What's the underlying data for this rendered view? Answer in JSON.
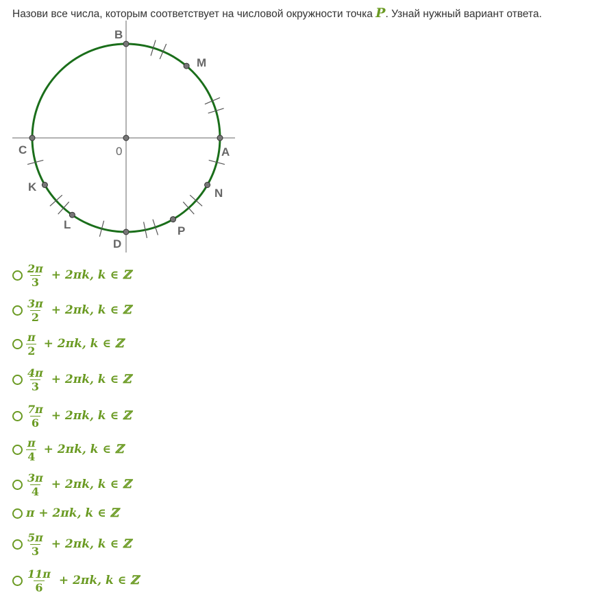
{
  "question": {
    "text_before": "Назови все числа, которым соответствует на числовой  окружности точка ",
    "variable": "P",
    "text_after": ". Узнай нужный вариант ответа."
  },
  "figure": {
    "labels": {
      "B": "B",
      "M": "M",
      "A": "A",
      "C": "C",
      "K": "K",
      "N": "N",
      "L": "L",
      "D": "D",
      "P": "P",
      "zero": "0"
    },
    "colors": {
      "circle": "#1a6e1a",
      "axis": "#999999",
      "point_fill": "#777777",
      "label": "#666666"
    }
  },
  "options": [
    {
      "frac": true,
      "num": "2π",
      "den": "3",
      "tail": " + 2πk, k ∈ ℤ"
    },
    {
      "frac": true,
      "num": "3π",
      "den": "2",
      "tail": " + 2πk, k ∈ ℤ"
    },
    {
      "frac": true,
      "num": "π",
      "den": "2",
      "tail": " + 2πk, k ∈ ℤ"
    },
    {
      "frac": true,
      "num": "4π",
      "den": "3",
      "tail": " + 2πk, k ∈ ℤ"
    },
    {
      "frac": true,
      "num": "7π",
      "den": "6",
      "tail": " + 2πk, k ∈ ℤ"
    },
    {
      "frac": true,
      "num": "π",
      "den": "4",
      "tail": " + 2πk, k ∈ ℤ"
    },
    {
      "frac": true,
      "num": "3π",
      "den": "4",
      "tail": " + 2πk, k ∈ ℤ"
    },
    {
      "frac": false,
      "text": "π + 2πk, k ∈ ℤ"
    },
    {
      "frac": true,
      "num": "5π",
      "den": "3",
      "tail": " + 2πk, k ∈ ℤ"
    },
    {
      "frac": true,
      "num": "11π",
      "den": "6",
      "tail": " + 2πk, k ∈ ℤ"
    }
  ],
  "colors": {
    "accent": "#6a9a22"
  }
}
